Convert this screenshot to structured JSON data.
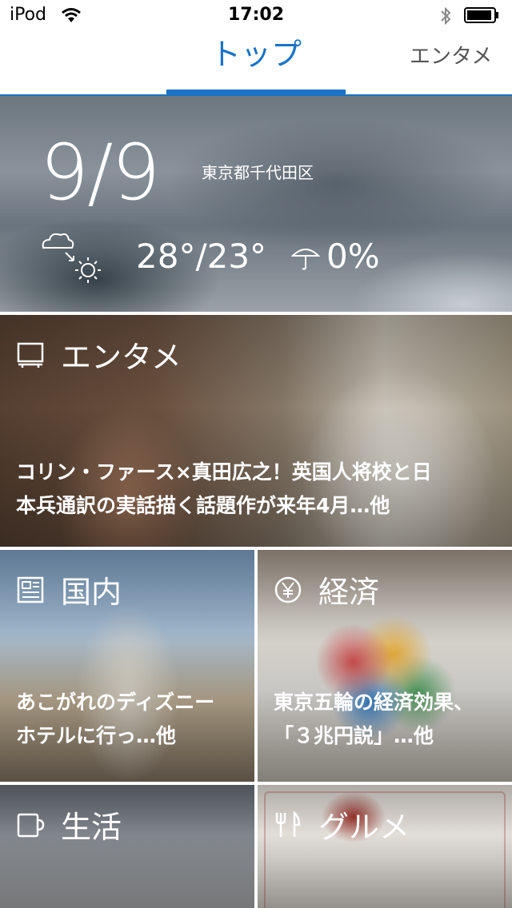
{
  "status_bar": {
    "carrier": "iPod",
    "time": "17:02"
  },
  "tabs": {
    "active": "トップ",
    "next": "エンタメ",
    "accent": "#1a73c8"
  },
  "weather": {
    "date": "9/9",
    "location": "東京都千代田区",
    "temperature": "28°/23°",
    "rain": "0%",
    "icon": "cloudy-then-sunny-icon"
  },
  "cards": [
    {
      "category": "エンタメ",
      "icon": "tv-icon",
      "headline_1": "コリン・ファース×真田広之！英国人将校と日",
      "headline_2": "本兵通訳の実話描く話題作が来年4月…他"
    },
    {
      "category": "国内",
      "icon": "newspaper-icon",
      "headline_1": "あこがれのディズニー",
      "headline_2": "ホテルに行っ…他"
    },
    {
      "category": "経済",
      "icon": "yen-icon",
      "headline_1": "東京五輪の経済効果、",
      "headline_2": "「３兆円説」…他"
    },
    {
      "category": "生活",
      "icon": "mug-icon"
    },
    {
      "category": "グルメ",
      "icon": "fork-knife-icon"
    }
  ]
}
